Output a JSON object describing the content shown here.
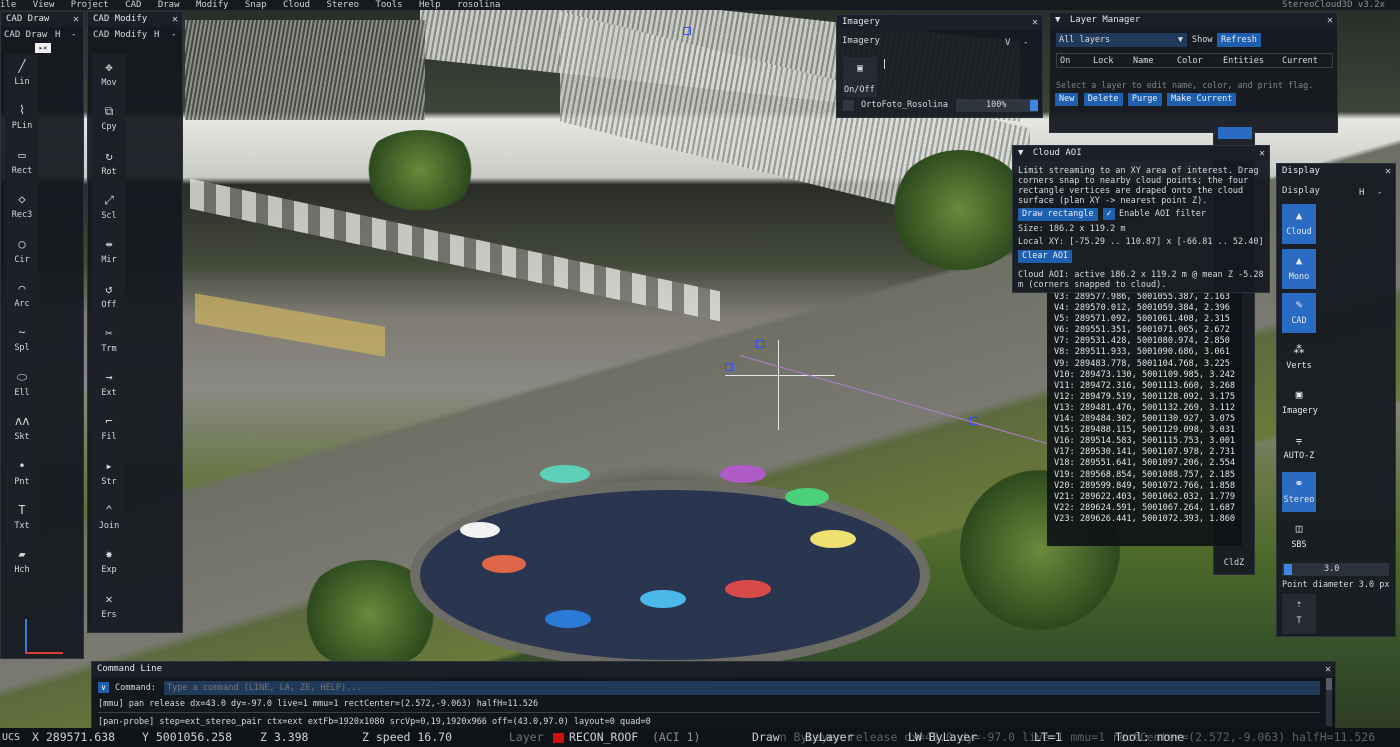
{
  "menubar": {
    "items": [
      "ile",
      "View",
      "Project",
      "CAD",
      "Draw",
      "Modify",
      "Snap",
      "Cloud",
      "Stereo",
      "Tools",
      "Help"
    ],
    "project": "rosolina",
    "version": "StereoCloud3D v3.2x"
  },
  "cad_draw": {
    "title": "CAD Draw",
    "header": "CAD Draw",
    "h_btn": "H",
    "dash_btn": "-",
    "tools": [
      {
        "icon": "line-icon",
        "glyph": "╱",
        "label": "Lin"
      },
      {
        "icon": "polyline-icon",
        "glyph": "⌇",
        "label": "PLin"
      },
      {
        "icon": "rectangle-icon",
        "glyph": "▭",
        "label": "Rect"
      },
      {
        "icon": "rectangle-3pt-icon",
        "glyph": "◇",
        "label": "Rec3"
      },
      {
        "icon": "circle-icon",
        "glyph": "○",
        "label": "Cir"
      },
      {
        "icon": "arc-icon",
        "glyph": "⌒",
        "label": "Arc"
      },
      {
        "icon": "spline-icon",
        "glyph": "∼",
        "label": "Spl"
      },
      {
        "icon": "ellipse-icon",
        "glyph": "⬭",
        "label": "Ell"
      },
      {
        "icon": "sketch-icon",
        "glyph": "ʌʌ",
        "label": "Skt"
      },
      {
        "icon": "point-icon",
        "glyph": "•",
        "label": "Pnt"
      },
      {
        "icon": "text-icon",
        "glyph": "T",
        "label": "Txt"
      },
      {
        "icon": "hatch-icon",
        "glyph": "▰",
        "label": "Hch"
      }
    ]
  },
  "cad_modify": {
    "title": "CAD Modify",
    "header": "CAD Modify",
    "h_btn": "H",
    "dash_btn": "-",
    "tools": [
      {
        "icon": "move-icon",
        "glyph": "✥",
        "label": "Mov"
      },
      {
        "icon": "copy-icon",
        "glyph": "⧉",
        "label": "Cpy"
      },
      {
        "icon": "rotate-icon",
        "glyph": "↻",
        "label": "Rot"
      },
      {
        "icon": "scale-icon",
        "glyph": "⤢",
        "label": "Scl"
      },
      {
        "icon": "mirror-icon",
        "glyph": "⇹",
        "label": "Mir"
      },
      {
        "icon": "offset-icon",
        "glyph": "↺",
        "label": "Off"
      },
      {
        "icon": "trim-icon",
        "glyph": "✂",
        "label": "Trm"
      },
      {
        "icon": "extend-icon",
        "glyph": "→",
        "label": "Ext"
      },
      {
        "icon": "fillet-icon",
        "glyph": "⌐",
        "label": "Fil"
      },
      {
        "icon": "stretch-icon",
        "glyph": "▸",
        "label": "Str"
      },
      {
        "icon": "join-icon",
        "glyph": "⌃",
        "label": "Join"
      },
      {
        "icon": "explode-icon",
        "glyph": "✸",
        "label": "Exp"
      },
      {
        "icon": "erase-icon",
        "glyph": "✕",
        "label": "Ers"
      }
    ]
  },
  "imagery": {
    "title": "Imagery",
    "header": "Imagery",
    "v_btn": "V",
    "dash_btn": "-",
    "onoff_label": "On/Off",
    "layer_name": "OrtoFoto_Rosolina",
    "opacity": "100%",
    "opacity_fraction": 1.0
  },
  "layer_manager": {
    "title": "Layer Manager",
    "filter": "All layers",
    "show_label": "Show",
    "refresh_label": "Refresh",
    "columns": [
      "On",
      "Lock",
      "Name",
      "Color",
      "Entities",
      "Current"
    ],
    "hint": "Select a layer to edit name, color, and print flag.",
    "buttons": [
      "New",
      "Delete",
      "Purge",
      "Make Current"
    ]
  },
  "cloud_aoi": {
    "title": "Cloud AOI",
    "description": "Limit streaming to an XY area of interest. Drag corners snap to nearby cloud points; the four rectangle vertices are draped onto the cloud surface (plan XY -> nearest point Z).",
    "draw_label": "Draw rectangle",
    "enable_label": "Enable AOI filter",
    "enabled": true,
    "size": "Size: 186.2 x 119.2 m",
    "local_xy": "Local XY: [-75.29 .. 110.87] x [-66.81 .. 52.40]",
    "clear_label": "Clear AOI",
    "status": "Cloud AOI: active 186.2 x 119.2 m @ mean Z -5.28 m (corners snapped to cloud)."
  },
  "vertices": [
    "V3: 289577.986, 5001055.387, 2.163",
    "V4: 289570.012, 5001059.384, 2.396",
    "V5: 289571.092, 5001061.408, 2.315",
    "V6: 289551.351, 5001071.065, 2.672",
    "V7: 289531.428, 5001080.974, 2.850",
    "V8: 289511.933, 5001090.686, 3.061",
    "V9: 289483.778, 5001104.768, 3.225",
    "V10: 289473.130, 5001109.985, 3.242",
    "V11: 289472.316, 5001113.660, 3.268",
    "V12: 289479.519, 5001128.092, 3.175",
    "V13: 289481.476, 5001132.269, 3.112",
    "V14: 289484.302, 5001130.927, 3.075",
    "V15: 289488.115, 5001129.098, 3.031",
    "V16: 289514.583, 5001115.753, 3.001",
    "V17: 289530.141, 5001107.978, 2.731",
    "V18: 289551.641, 5001097.206, 2.554",
    "V19: 289568.854, 5001088.757, 2.185",
    "V20: 289599.849, 5001072.766, 1.858",
    "V21: 289622.403, 5001062.032, 1.779",
    "V22: 289624.591, 5001067.264, 1.687",
    "V23: 289626.441, 5001072.393, 1.860"
  ],
  "side_label": "CldZ",
  "display": {
    "title": "Display",
    "header": "Display",
    "h_btn": "H",
    "dash_btn": "-",
    "buttons": [
      {
        "icon": "cloud-icon",
        "glyph": "▲",
        "label": "Cloud",
        "on": true
      },
      {
        "icon": "mono-icon",
        "glyph": "▲",
        "label": "Mono",
        "on": true
      },
      {
        "icon": "cad-icon",
        "glyph": "✎",
        "label": "CAD",
        "on": true
      },
      {
        "icon": "vertices-icon",
        "glyph": "⁂",
        "label": "Verts",
        "on": false
      },
      {
        "icon": "imagery-icon",
        "glyph": "▣",
        "label": "Imagery",
        "on": false
      },
      {
        "icon": "auto-z-icon",
        "glyph": "⩦",
        "label": "AUTO-Z",
        "on": false
      },
      {
        "icon": "stereo-icon",
        "glyph": "⚭",
        "label": "Stereo",
        "on": true
      },
      {
        "icon": "sbs-icon",
        "glyph": "◫",
        "label": "SBS",
        "on": false
      }
    ],
    "point_size_value": "3.0",
    "point_diameter": "Point diameter 3.0 px",
    "t_label": "T"
  },
  "command_line": {
    "title": "Command Line",
    "command_label": "Command:",
    "placeholder": "Type a command (LINE, LA, ZE, HELP)...",
    "log": [
      "[mmu] pan release dx=43.0 dy=-97.0 live=1 mmu=1 rectCenter=(2.572,-9.063) halfH=11.526",
      "[pan-probe] step=ext_stereo_pair ctx=ext extFb=1920x1080 srcVp=0,19,1920x966 off=(43.0,97.0) layout=0 quad=0"
    ]
  },
  "status": {
    "ucs": "UCS",
    "x": "X 289571.638",
    "y": "Y 5001056.258",
    "z": "Z 3.398",
    "zspeed": "Z speed 16.70",
    "layer_label": "Layer",
    "layer_name": "RECON_ROOF",
    "layer_aci": "(ACI 1)",
    "overlay": "Drawn  ByLayer  release dx=43.0 dy=-97.0 live=1 mmu=1 rectCenter=(2.572,-9.063) halfH=11.526",
    "draw_label": "Draw",
    "bylayer": "ByLayer",
    "lw": "LW ByLayer",
    "lt": "LT=1",
    "tool": "Tool: none",
    "layer_color": "#d01010"
  }
}
